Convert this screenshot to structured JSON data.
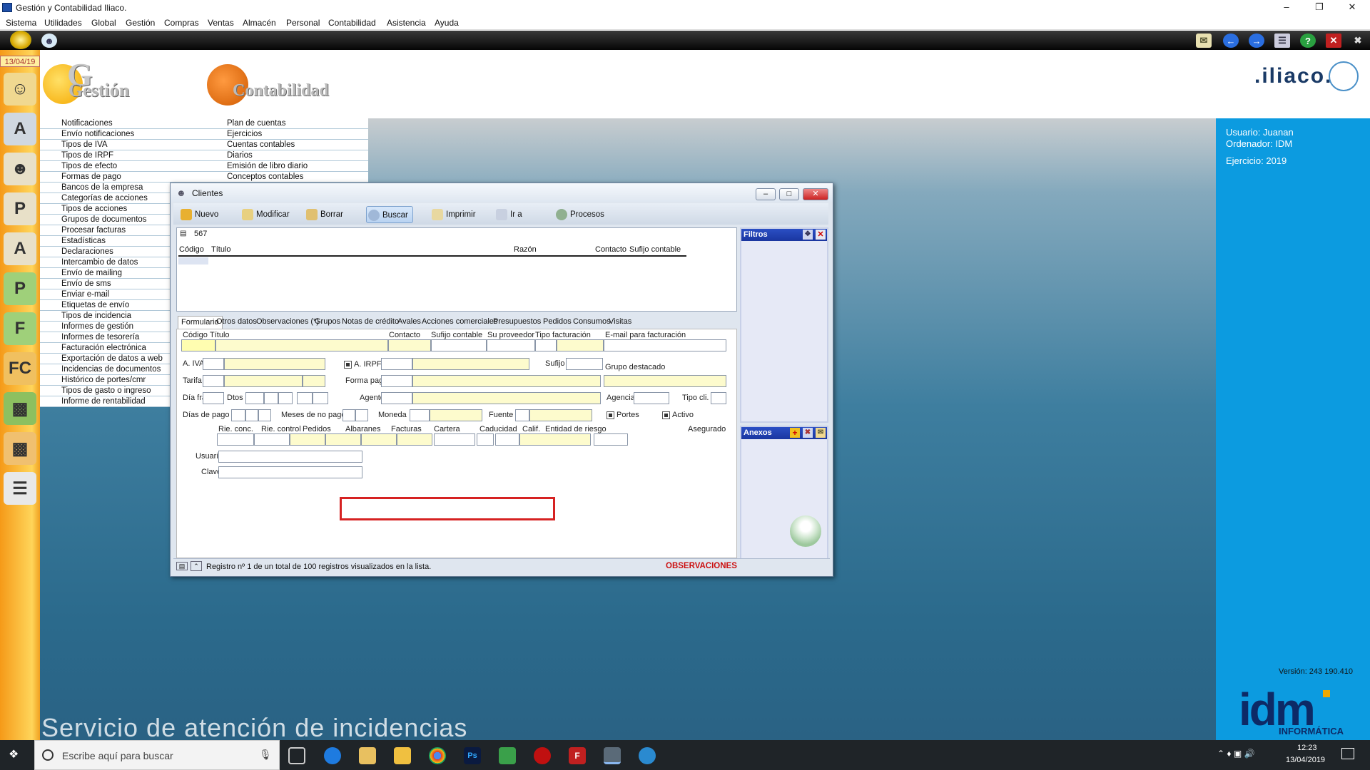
{
  "app": {
    "title": "Gestión y Contabilidad Iliaco.",
    "date_badge": "13/04/19"
  },
  "menu": [
    "Sistema",
    "Utilidades",
    "Global",
    "Gestión",
    "Compras",
    "Ventas",
    "Almacén",
    "Personal",
    "Contabilidad",
    "Asistencia",
    "Ayuda"
  ],
  "header": {
    "gestion_logo": "Gestión",
    "contabilidad_logo": "Contabilidad",
    "brand": ".iliaco."
  },
  "gestion_menu": [
    "Notificaciones",
    "Envío notificaciones",
    "Tipos de IVA",
    "Tipos de IRPF",
    "Tipos de efecto",
    "Formas de pago",
    "Bancos de la empresa",
    "Categorías de acciones",
    "Tipos de acciones",
    "Grupos de documentos",
    "Procesar facturas",
    "Estadísticas",
    "Declaraciones",
    "Intercambio de datos",
    "Envío de mailing",
    "Envío de sms",
    "Enviar e-mail",
    "Etiquetas de envío",
    "Tipos de incidencia",
    "Informes de gestión",
    "Informes de tesorería",
    "Facturación electrónica",
    "Exportación de datos a web",
    "Incidencias de documentos",
    "Histórico de portes/cmr",
    "Tipos de gasto o ingreso",
    "Informe de rentabilidad"
  ],
  "contabilidad_menu": [
    "Plan de cuentas",
    "Ejercicios",
    "Cuentas contables",
    "Diarios",
    "Emisión de libro diario",
    "Conceptos contables"
  ],
  "user_panel": {
    "usuario": "Usuario: Juanan",
    "ordenador": "Ordenador: IDM",
    "ejercicio": "Ejercicio: 2019"
  },
  "version": "Versión: 243 190.410",
  "idm_logo": {
    "main": "idm",
    "sub": "INFORMÁTICA"
  },
  "footer_text": "Servicio de atención de incidencias",
  "window": {
    "title": "Clientes",
    "toolbar": [
      "Nuevo",
      "Modificar",
      "Borrar",
      "Buscar",
      "Imprimir",
      "Ir a",
      "Procesos"
    ],
    "record_count": "567",
    "list_columns": [
      "Código",
      "Título",
      "Razón",
      "Contacto",
      "Sufijo contable"
    ],
    "filtros": "Filtros",
    "anexos": "Anexos",
    "tabs": [
      "Formulario",
      "Otros datos",
      "Observaciones (*)",
      "Grupos",
      "Notas de crédito",
      "Avales",
      "Acciones comerciales",
      "Presupuestos",
      "Pedidos",
      "Consumos",
      "Visitas"
    ],
    "form": {
      "codigo": "Código",
      "titulo": "Título",
      "contacto": "Contacto",
      "sufijo_contable": "Sufijo contable",
      "su_proveedor": "Su proveedor",
      "tipo_facturacion": "Tipo facturación",
      "email_facturacion": "E-mail para facturación",
      "a_iva": "A. IVA",
      "a_irpf": "A. IRPF",
      "sufijo": "Sufijo",
      "grupo_destacado": "Grupo destacado",
      "tarifa": "Tarifa",
      "forma_pago": "Forma pago",
      "dia_fra": "Día fra",
      "dtos": "Dtos",
      "agente": "Agente",
      "agencia": "Agencia",
      "tipo_cli": "Tipo cli.",
      "dias_pago": "Días de pago",
      "meses_no_pago": "Meses de no pago",
      "moneda": "Moneda",
      "fuente": "Fuente",
      "portes": "Portes",
      "activo": "Activo",
      "rie_conc": "Rie. conc.",
      "rie_control": "Rie. control",
      "pedidos": "Pedidos",
      "albaranes": "Albaranes",
      "facturas": "Facturas",
      "cartera": "Cartera",
      "caducidad": "Caducidad",
      "calif": "Calif.",
      "entidad_riesgo": "Entidad de riesgo",
      "asegurado": "Asegurado",
      "usuario": "Usuario",
      "clave": "Clave"
    },
    "status_text": "Registro nº 1 de un total de 100 registros visualizados en la lista.",
    "observaciones": "OBSERVACIONES"
  },
  "taskbar": {
    "search_placeholder": "Escribe aquí para buscar",
    "time": "12:23",
    "date": "13/04/2019"
  }
}
